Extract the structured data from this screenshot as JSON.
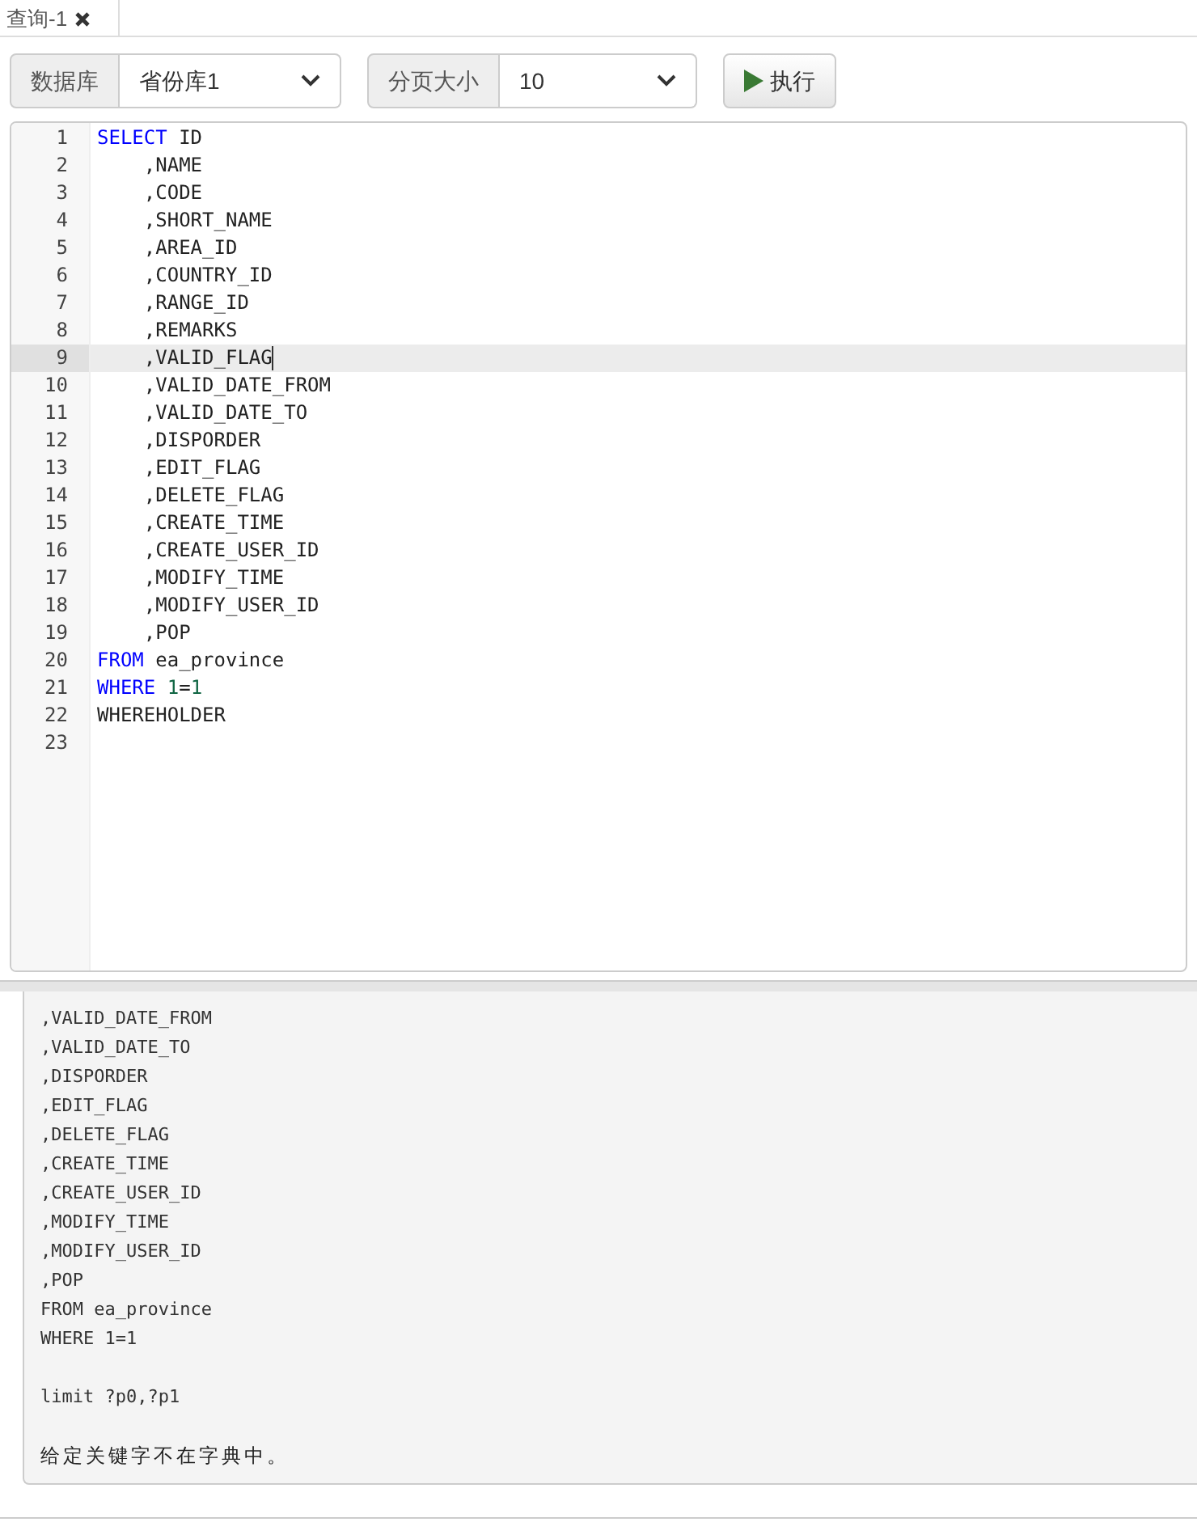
{
  "tabs": [
    {
      "label": "查询-1",
      "selected": true
    }
  ],
  "toolbar": {
    "database_label": "数据库",
    "database_value": "省份库1",
    "page_size_label": "分页大小",
    "page_size_value": "10",
    "run_button": "执行"
  },
  "editor": {
    "lines": [
      {
        "number": "1",
        "active": false,
        "tokens": [
          {
            "kind": "keyword",
            "text": "SELECT"
          },
          {
            "kind": "plain",
            "text": " ID"
          }
        ]
      },
      {
        "number": "2",
        "active": false,
        "tokens": [
          {
            "kind": "plain",
            "text": "    ,NAME"
          }
        ]
      },
      {
        "number": "3",
        "active": false,
        "tokens": [
          {
            "kind": "plain",
            "text": "    ,CODE"
          }
        ]
      },
      {
        "number": "4",
        "active": false,
        "tokens": [
          {
            "kind": "plain",
            "text": "    ,SHORT_NAME"
          }
        ]
      },
      {
        "number": "5",
        "active": false,
        "tokens": [
          {
            "kind": "plain",
            "text": "    ,AREA_ID"
          }
        ]
      },
      {
        "number": "6",
        "active": false,
        "tokens": [
          {
            "kind": "plain",
            "text": "    ,COUNTRY_ID"
          }
        ]
      },
      {
        "number": "7",
        "active": false,
        "tokens": [
          {
            "kind": "plain",
            "text": "    ,RANGE_ID"
          }
        ]
      },
      {
        "number": "8",
        "active": false,
        "tokens": [
          {
            "kind": "plain",
            "text": "    ,REMARKS"
          }
        ]
      },
      {
        "number": "9",
        "active": true,
        "tokens": [
          {
            "kind": "plain",
            "text": "    ,VALID_FLAG"
          }
        ]
      },
      {
        "number": "10",
        "active": false,
        "tokens": [
          {
            "kind": "plain",
            "text": "    ,VALID_DATE_FROM"
          }
        ]
      },
      {
        "number": "11",
        "active": false,
        "tokens": [
          {
            "kind": "plain",
            "text": "    ,VALID_DATE_TO"
          }
        ]
      },
      {
        "number": "12",
        "active": false,
        "tokens": [
          {
            "kind": "plain",
            "text": "    ,DISPORDER"
          }
        ]
      },
      {
        "number": "13",
        "active": false,
        "tokens": [
          {
            "kind": "plain",
            "text": "    ,EDIT_FLAG"
          }
        ]
      },
      {
        "number": "14",
        "active": false,
        "tokens": [
          {
            "kind": "plain",
            "text": "    ,DELETE_FLAG"
          }
        ]
      },
      {
        "number": "15",
        "active": false,
        "tokens": [
          {
            "kind": "plain",
            "text": "    ,CREATE_TIME"
          }
        ]
      },
      {
        "number": "16",
        "active": false,
        "tokens": [
          {
            "kind": "plain",
            "text": "    ,CREATE_USER_ID"
          }
        ]
      },
      {
        "number": "17",
        "active": false,
        "tokens": [
          {
            "kind": "plain",
            "text": "    ,MODIFY_TIME"
          }
        ]
      },
      {
        "number": "18",
        "active": false,
        "tokens": [
          {
            "kind": "plain",
            "text": "    ,MODIFY_USER_ID"
          }
        ]
      },
      {
        "number": "19",
        "active": false,
        "tokens": [
          {
            "kind": "plain",
            "text": "    ,POP"
          }
        ]
      },
      {
        "number": "20",
        "active": false,
        "tokens": [
          {
            "kind": "keyword",
            "text": "FROM"
          },
          {
            "kind": "plain",
            "text": " ea_province"
          }
        ]
      },
      {
        "number": "21",
        "active": false,
        "tokens": [
          {
            "kind": "keyword",
            "text": "WHERE"
          },
          {
            "kind": "number",
            "text": "1",
            "space_before": true
          },
          {
            "kind": "plain",
            "text": "="
          },
          {
            "kind": "number",
            "text": "1"
          }
        ]
      },
      {
        "number": "22",
        "active": false,
        "tokens": [
          {
            "kind": "plain",
            "text": "WHEREHOLDER"
          }
        ]
      },
      {
        "number": "23",
        "active": false
      }
    ]
  },
  "output": {
    "sql_lines": [
      ",VALID_DATE_FROM",
      ",VALID_DATE_TO",
      ",DISPORDER",
      ",EDIT_FLAG",
      ",DELETE_FLAG",
      ",CREATE_TIME",
      ",CREATE_USER_ID",
      ",MODIFY_TIME",
      ",MODIFY_USER_ID",
      ",POP",
      "FROM ea_province",
      "WHERE 1=1"
    ],
    "limit_line": "limit ?p0,?p1",
    "message": "给定关键字不在字典中。"
  }
}
